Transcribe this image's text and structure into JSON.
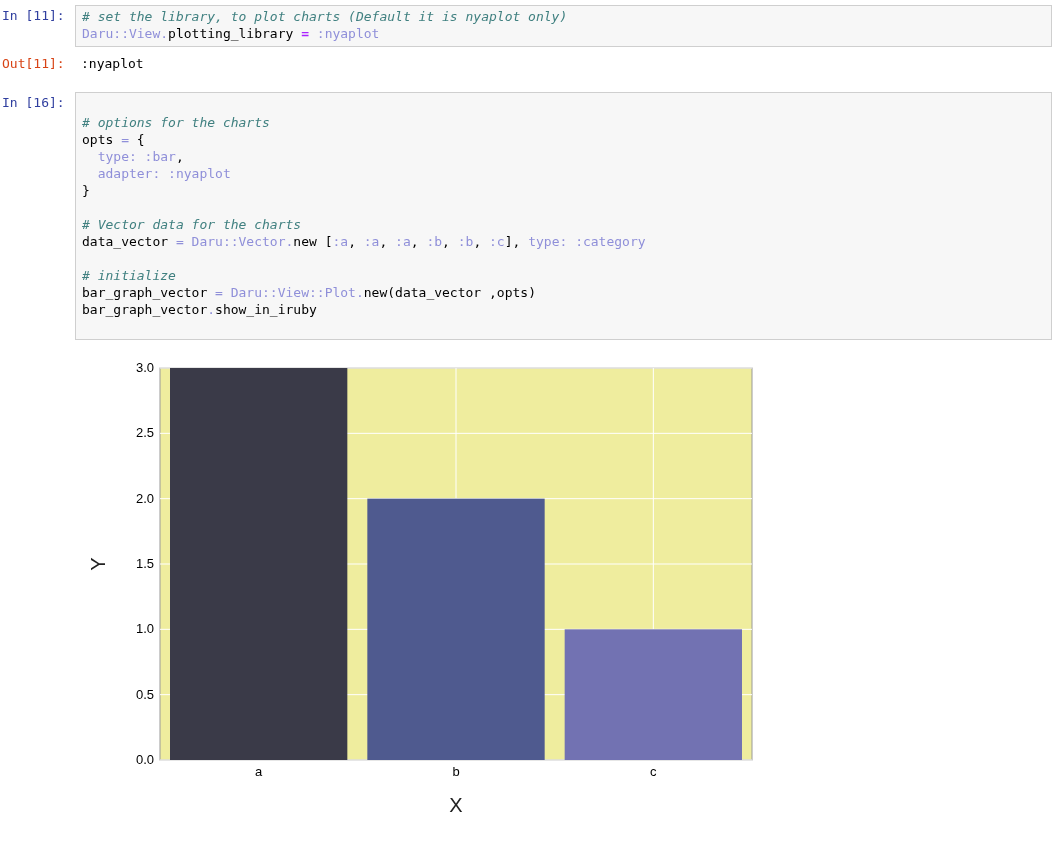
{
  "cells": [
    {
      "kind": "input",
      "prompt": "In [11]:",
      "blocks": [
        [
          [
            {
              "kind": "comment",
              "text": "# set the library, to plot charts (Default it is nyaplot only)"
            }
          ],
          [
            {
              "kind": "const",
              "text": "Daru::View."
            },
            {
              "kind": "plain",
              "text": "plotting_library "
            },
            {
              "kind": "op",
              "text": "="
            },
            {
              "kind": "const",
              "text": " :nyaplot"
            }
          ]
        ]
      ]
    },
    {
      "kind": "output",
      "prompt": "Out[11]:",
      "text": ":nyaplot"
    },
    {
      "kind": "input",
      "prompt": "In [16]:",
      "blocks": [
        [
          [
            {
              "kind": "comment",
              "text": "# options for the charts"
            }
          ],
          [
            {
              "kind": "plain",
              "text": "opts "
            },
            {
              "kind": "const",
              "text": "="
            },
            {
              "kind": "plain",
              "text": " {"
            }
          ],
          [
            {
              "kind": "const",
              "text": "  type: :bar"
            },
            {
              "kind": "plain",
              "text": ","
            }
          ],
          [
            {
              "kind": "const",
              "text": "  adapter: :nyaplot"
            }
          ],
          [
            {
              "kind": "plain",
              "text": "}"
            }
          ]
        ],
        [
          [
            {
              "kind": "comment",
              "text": "# Vector data for the charts"
            }
          ],
          [
            {
              "kind": "plain",
              "text": "data_vector "
            },
            {
              "kind": "const",
              "text": "= Daru::Vector."
            },
            {
              "kind": "plain",
              "text": "new ["
            },
            {
              "kind": "const",
              "text": ":a"
            },
            {
              "kind": "plain",
              "text": ", "
            },
            {
              "kind": "const",
              "text": ":a"
            },
            {
              "kind": "plain",
              "text": ", "
            },
            {
              "kind": "const",
              "text": ":a"
            },
            {
              "kind": "plain",
              "text": ", "
            },
            {
              "kind": "const",
              "text": ":b"
            },
            {
              "kind": "plain",
              "text": ", "
            },
            {
              "kind": "const",
              "text": ":b"
            },
            {
              "kind": "plain",
              "text": ", "
            },
            {
              "kind": "const",
              "text": ":c"
            },
            {
              "kind": "plain",
              "text": "], "
            },
            {
              "kind": "const",
              "text": "type: :category"
            }
          ]
        ],
        [
          [
            {
              "kind": "comment",
              "text": "# initialize"
            }
          ],
          [
            {
              "kind": "plain",
              "text": "bar_graph_vector "
            },
            {
              "kind": "const",
              "text": "= Daru::View::Plot."
            },
            {
              "kind": "plain",
              "text": "new(data_vector ,opts)"
            }
          ],
          [
            {
              "kind": "plain",
              "text": "bar_graph_vector"
            },
            {
              "kind": "const",
              "text": "."
            },
            {
              "kind": "plain",
              "text": "show_in_iruby"
            }
          ]
        ]
      ]
    }
  ],
  "chart_data": {
    "type": "bar",
    "xlabel": "X",
    "ylabel": "Y",
    "categories": [
      "a",
      "b",
      "c"
    ],
    "series": [
      {
        "color": "#3a3a48",
        "values": [
          3,
          null,
          null
        ]
      },
      {
        "color": "#4f5a8f",
        "values": [
          null,
          2,
          null
        ]
      },
      {
        "color": "#7272b2",
        "values": [
          null,
          null,
          1
        ]
      }
    ],
    "grid": true,
    "ylim": [
      0,
      3
    ],
    "yticks": [
      {
        "value": 0,
        "label": "0.0"
      },
      {
        "value": 0.5,
        "label": "0.5"
      },
      {
        "value": 1,
        "label": "1.0"
      },
      {
        "value": 1.5,
        "label": "1.5"
      },
      {
        "value": 2,
        "label": "2.0"
      },
      {
        "value": 2.5,
        "label": "2.5"
      },
      {
        "value": 3,
        "label": "3.0"
      }
    ]
  }
}
